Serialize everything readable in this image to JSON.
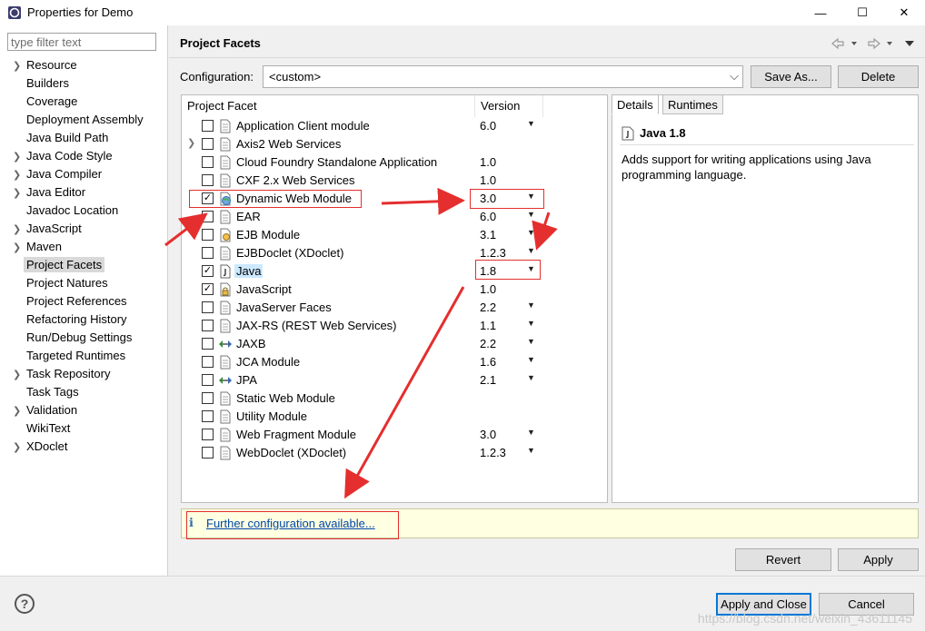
{
  "window": {
    "title": "Properties for Demo",
    "minimize": "—",
    "maximize": "☐",
    "close": "✕"
  },
  "filter": {
    "placeholder": "type filter text"
  },
  "nav": [
    {
      "label": "Resource",
      "expandable": true
    },
    {
      "label": "Builders",
      "expandable": false
    },
    {
      "label": "Coverage",
      "expandable": false
    },
    {
      "label": "Deployment Assembly",
      "expandable": false
    },
    {
      "label": "Java Build Path",
      "expandable": false
    },
    {
      "label": "Java Code Style",
      "expandable": true
    },
    {
      "label": "Java Compiler",
      "expandable": true
    },
    {
      "label": "Java Editor",
      "expandable": true
    },
    {
      "label": "Javadoc Location",
      "expandable": false
    },
    {
      "label": "JavaScript",
      "expandable": true
    },
    {
      "label": "Maven",
      "expandable": true
    },
    {
      "label": "Project Facets",
      "expandable": false,
      "selected": true
    },
    {
      "label": "Project Natures",
      "expandable": false
    },
    {
      "label": "Project References",
      "expandable": false
    },
    {
      "label": "Refactoring History",
      "expandable": false
    },
    {
      "label": "Run/Debug Settings",
      "expandable": false
    },
    {
      "label": "Targeted Runtimes",
      "expandable": false
    },
    {
      "label": "Task Repository",
      "expandable": true
    },
    {
      "label": "Task Tags",
      "expandable": false
    },
    {
      "label": "Validation",
      "expandable": true
    },
    {
      "label": "WikiText",
      "expandable": false
    },
    {
      "label": "XDoclet",
      "expandable": true
    }
  ],
  "page": {
    "heading": "Project Facets"
  },
  "config": {
    "label": "Configuration:",
    "value": "<custom>",
    "save_as": "Save As...",
    "delete": "Delete"
  },
  "table": {
    "col_facet": "Project Facet",
    "col_version": "Version",
    "rows": [
      {
        "name": "Application Client module",
        "version": "6.0",
        "checked": false,
        "dropdown": true,
        "expandable": false,
        "icon": "doc-icon"
      },
      {
        "name": "Axis2 Web Services",
        "version": "",
        "checked": false,
        "dropdown": false,
        "expandable": true,
        "icon": "doc-icon"
      },
      {
        "name": "Cloud Foundry Standalone Application",
        "version": "1.0",
        "checked": false,
        "dropdown": false,
        "expandable": false,
        "icon": "doc-icon"
      },
      {
        "name": "CXF 2.x Web Services",
        "version": "1.0",
        "checked": false,
        "dropdown": false,
        "expandable": false,
        "icon": "doc-icon"
      },
      {
        "name": "Dynamic Web Module",
        "version": "3.0",
        "checked": true,
        "dropdown": true,
        "expandable": false,
        "icon": "globe-icon"
      },
      {
        "name": "EAR",
        "version": "6.0",
        "checked": false,
        "dropdown": true,
        "expandable": false,
        "icon": "doc-icon"
      },
      {
        "name": "EJB Module",
        "version": "3.1",
        "checked": false,
        "dropdown": true,
        "expandable": false,
        "icon": "ejb-icon"
      },
      {
        "name": "EJBDoclet (XDoclet)",
        "version": "1.2.3",
        "checked": false,
        "dropdown": true,
        "expandable": false,
        "icon": "doc-icon"
      },
      {
        "name": "Java",
        "version": "1.8",
        "checked": true,
        "dropdown": true,
        "expandable": false,
        "icon": "java-icon",
        "highlight": true
      },
      {
        "name": "JavaScript",
        "version": "1.0",
        "checked": true,
        "dropdown": false,
        "expandable": false,
        "icon": "lock-doc-icon"
      },
      {
        "name": "JavaServer Faces",
        "version": "2.2",
        "checked": false,
        "dropdown": true,
        "expandable": false,
        "icon": "doc-icon"
      },
      {
        "name": "JAX-RS (REST Web Services)",
        "version": "1.1",
        "checked": false,
        "dropdown": true,
        "expandable": false,
        "icon": "doc-icon"
      },
      {
        "name": "JAXB",
        "version": "2.2",
        "checked": false,
        "dropdown": true,
        "expandable": false,
        "icon": "arrows-icon"
      },
      {
        "name": "JCA Module",
        "version": "1.6",
        "checked": false,
        "dropdown": true,
        "expandable": false,
        "icon": "doc-icon"
      },
      {
        "name": "JPA",
        "version": "2.1",
        "checked": false,
        "dropdown": true,
        "expandable": false,
        "icon": "arrows-icon"
      },
      {
        "name": "Static Web Module",
        "version": "",
        "checked": false,
        "dropdown": false,
        "expandable": false,
        "icon": "doc-icon"
      },
      {
        "name": "Utility Module",
        "version": "",
        "checked": false,
        "dropdown": false,
        "expandable": false,
        "icon": "doc-icon"
      },
      {
        "name": "Web Fragment Module",
        "version": "3.0",
        "checked": false,
        "dropdown": true,
        "expandable": false,
        "icon": "doc-icon"
      },
      {
        "name": "WebDoclet (XDoclet)",
        "version": "1.2.3",
        "checked": false,
        "dropdown": true,
        "expandable": false,
        "icon": "doc-icon"
      }
    ]
  },
  "details": {
    "tab_details": "Details",
    "tab_runtimes": "Runtimes",
    "title": "Java 1.8",
    "description": "Adds support for writing applications using Java programming language."
  },
  "info": {
    "icon": "ℹ",
    "link": "Further configuration available..."
  },
  "buttons": {
    "revert": "Revert",
    "apply": "Apply",
    "apply_close": "Apply and Close",
    "cancel": "Cancel",
    "help": "?"
  },
  "watermark": "https://blog.csdn.net/weixin_43611145",
  "colors": {
    "annotation": "#e52e2e",
    "selection": "#cce8ff",
    "link": "#0047ab"
  }
}
